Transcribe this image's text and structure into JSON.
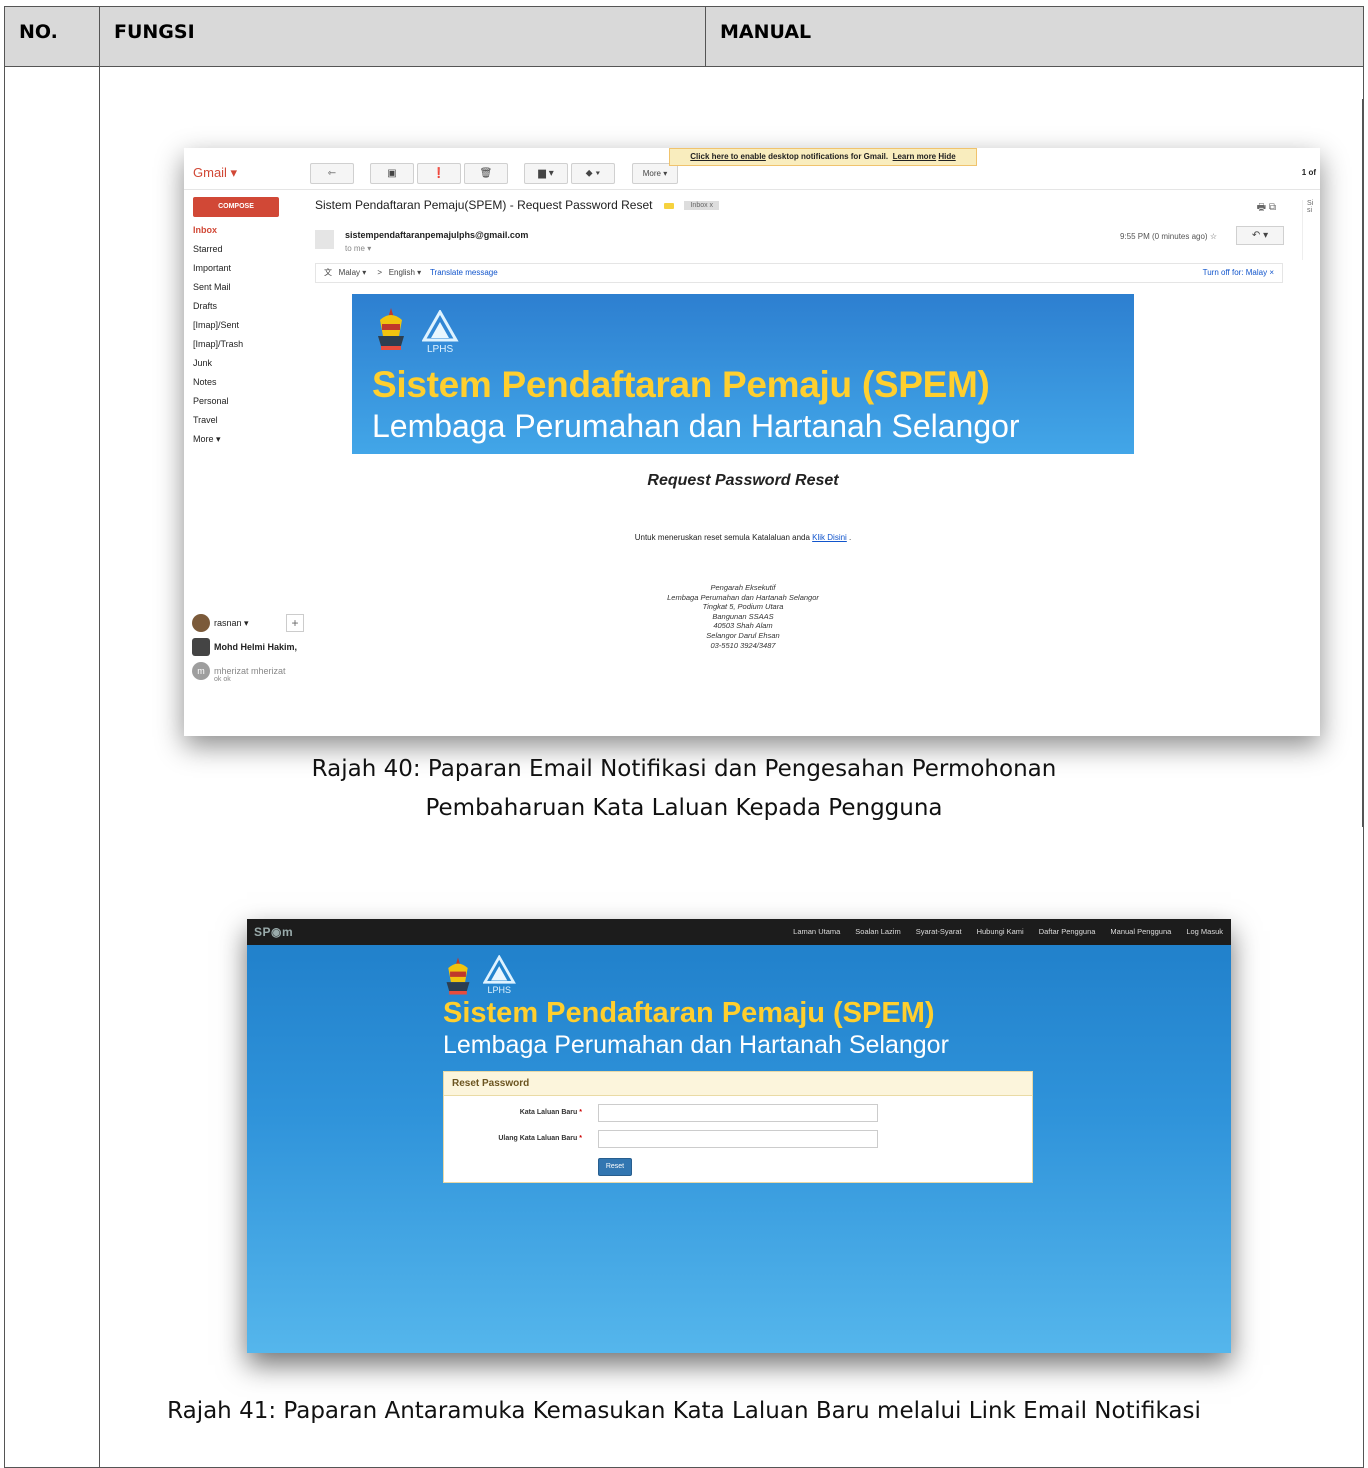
{
  "table": {
    "headers": {
      "no": "NO.",
      "fungsi": "FUNGSI",
      "manual": "MANUAL"
    }
  },
  "gmail": {
    "logo": "Gmail ▾",
    "toolbar": {
      "back": "⇽",
      "archive": "▣",
      "spam": "❗",
      "delete": "🗑",
      "folder": "▆ ▾",
      "label": "⬥ ▾",
      "more": "More ▾"
    },
    "notification": {
      "link": "Click here to enable",
      "text": " desktop notifications for Gmail.",
      "learn_more": "Learn more",
      "hide": "Hide"
    },
    "page_count": "1 of",
    "compose": "COMPOSE",
    "nav": [
      "Inbox",
      "Starred",
      "Important",
      "Sent Mail",
      "Drafts",
      "[Imap]/Sent",
      "[Imap]/Trash",
      "Junk",
      "Notes",
      "Personal",
      "Travel",
      "More ▾"
    ],
    "subject": "Sistem Pendaftaran Pemaju(SPEM) - Request Password Reset",
    "inbox_tag": "Inbox  x",
    "print_icons": "🖶 ⧉",
    "sender": "sistempendaftaranpemajulphs@gmail.com",
    "to_me": "to me ▾",
    "time": "9:55 PM (0 minutes ago)  ☆",
    "reply": "↶  ▾",
    "translate": {
      "from": "Malay ▾",
      "arrow": ">",
      "to": "English ▾",
      "action": "Translate message",
      "turn_off": "Turn off for: Malay  ×"
    },
    "right_col": "Si\nsi",
    "email": {
      "banner_title": "Sistem Pendaftaran Pemaju (SPEM)",
      "banner_subtitle": "Lembaga Perumahan dan Hartanah Selangor",
      "logo_text": "LPHS",
      "heading": "Request Password Reset",
      "body_text": "Untuk meneruskan reset semula Katalaluan anda ",
      "body_link": "Klik Disini",
      "body_end": " .",
      "signature": [
        "Pengarah Eksekutif",
        "Lembaga Perumahan dan Hartanah Selangor",
        "Tingkat 5, Podium Utara",
        "Bangunan SSAAS",
        "40503 Shah Alam",
        "Selangor Darul Ehsan",
        "03-5510 3924/3487"
      ]
    },
    "chat": {
      "user": "rasnan ▾",
      "plus": "+",
      "contact1": "Mohd Helmi Hakim,",
      "contact2": "mherizat mherizat",
      "contact2_sub": "ok ok",
      "contact2_initial": "m"
    }
  },
  "caption1": {
    "line1": "Rajah 40: Paparan Email Notifikasi dan Pengesahan Permohonan",
    "line2": "Pembaharuan Kata Laluan Kepada Pengguna"
  },
  "spem": {
    "brand": "SP◉m",
    "nav": [
      "Laman Utama",
      "Soalan Lazim",
      "Syarat-Syarat",
      "Hubungi Kami",
      "Daftar Pengguna",
      "Manual Pengguna",
      "Log Masuk"
    ],
    "title": "Sistem Pendaftaran Pemaju (SPEM)",
    "subtitle": "Lembaga Perumahan dan Hartanah Selangor",
    "logo_text": "LPHS",
    "panel_title": "Reset Password",
    "field1_label": "Kata Laluan Baru",
    "field2_label": "Ulang Kata Laluan Baru",
    "required_mark": "*",
    "button": "Reset"
  },
  "caption2": "Rajah 41: Paparan Antaramuka Kemasukan Kata Laluan Baru melalui Link Email Notifikasi",
  "colors": {
    "header_bg": "#d9d9d9",
    "gmail_red": "#d14836",
    "banner_blue": "#2d7fd0",
    "title_yellow": "#ffcf2e"
  }
}
